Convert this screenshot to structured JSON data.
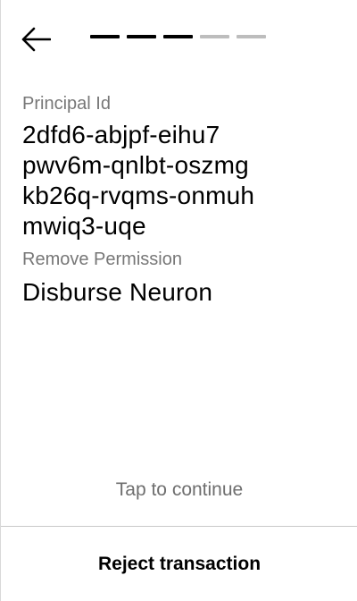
{
  "header": {
    "back_icon": "arrow-left-icon",
    "progress": {
      "total": 5,
      "completed": 3,
      "active_color": "#000000",
      "inactive_color": "#bdbdbd"
    }
  },
  "fields": {
    "principal_label": "Principal Id",
    "principal_lines": [
      "2dfd6-abjpf-eihu7",
      "pwv6m-qnlbt-oszmg",
      "kb26q-rvqms-onmuh",
      "mwiq3-uqe"
    ],
    "permission_label": "Remove Permission",
    "permission_value": "Disburse Neuron"
  },
  "footer": {
    "tap_hint": "Tap to continue",
    "reject_label": "Reject transaction"
  }
}
